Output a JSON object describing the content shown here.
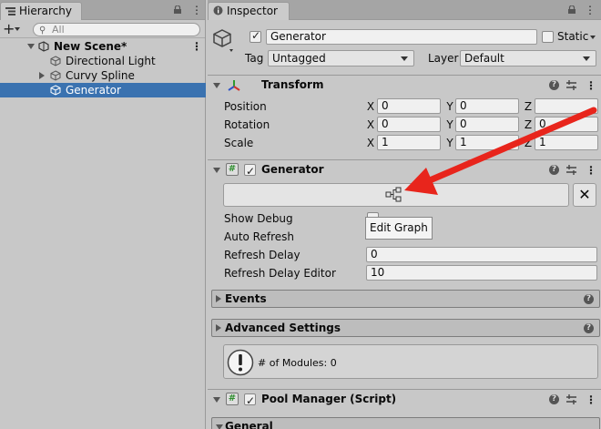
{
  "hierarchy": {
    "tab_label": "Hierarchy",
    "search_placeholder": "All",
    "items": [
      {
        "label": "New Scene*"
      },
      {
        "label": "Directional Light"
      },
      {
        "label": "Curvy Spline"
      },
      {
        "label": "Generator"
      }
    ]
  },
  "inspector": {
    "tab_label": "Inspector",
    "object_name": "Generator",
    "active_checked": true,
    "static_label": "Static",
    "static_checked": false,
    "tag_label": "Tag",
    "tag_value": "Untagged",
    "layer_label": "Layer",
    "layer_value": "Default"
  },
  "transform": {
    "title": "Transform",
    "rows": [
      {
        "label": "Position",
        "x": "0",
        "y": "0",
        "z": ""
      },
      {
        "label": "Rotation",
        "x": "0",
        "y": "0",
        "z": "0"
      },
      {
        "label": "Scale",
        "x": "1",
        "y": "1",
        "z": "1"
      }
    ],
    "axes": [
      "X",
      "Y",
      "Z"
    ]
  },
  "generator": {
    "title": "Generator",
    "checked": true,
    "close_glyph": "✕",
    "tooltip": "Edit Graph",
    "fields": [
      {
        "label": "Show Debug"
      },
      {
        "label": "Auto Refresh"
      },
      {
        "label": "Refresh Delay",
        "value": "0"
      },
      {
        "label": "Refresh Delay Editor",
        "value": "10"
      }
    ],
    "events_label": "Events",
    "advanced_label": "Advanced Settings",
    "info_text": "# of Modules: 0"
  },
  "pool_manager": {
    "title": "Pool Manager (Script)",
    "checked": true,
    "general_label": "General"
  },
  "colors": {
    "selection": "#3a72b0",
    "arrow": "#e8251c",
    "panel": "#c8c8c8"
  }
}
